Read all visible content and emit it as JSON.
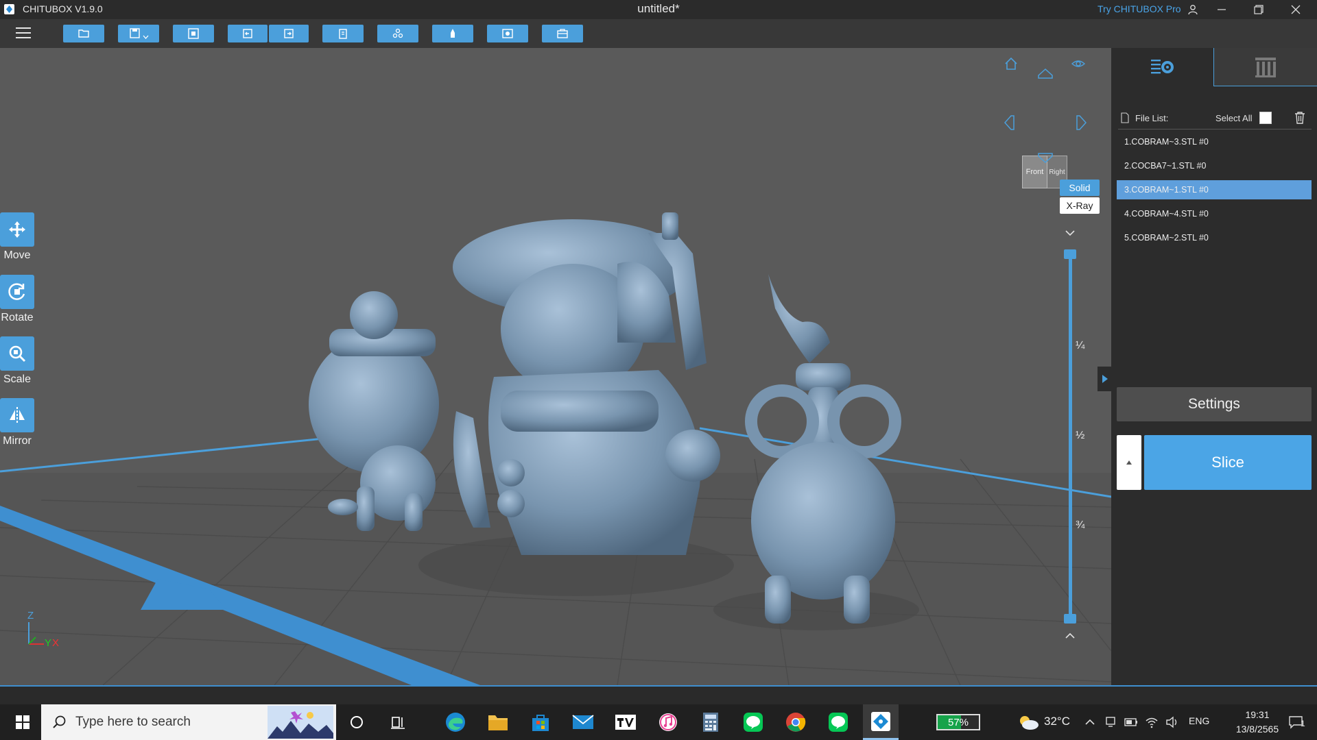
{
  "titlebar": {
    "app_title": "CHITUBOX V1.9.0",
    "document_title": "untitled*",
    "try_pro": "Try CHITUBOX Pro"
  },
  "toolbar": {
    "icons": [
      "open-file-icon",
      "save-icon",
      "screenshot-icon",
      "undo-icon",
      "redo-icon",
      "delete-icon",
      "support-icon",
      "hollow-icon",
      "auto-layout-icon",
      "package-icon"
    ]
  },
  "side_tools": [
    {
      "label": "Move",
      "icon": "move-icon"
    },
    {
      "label": "Rotate",
      "icon": "rotate-icon"
    },
    {
      "label": "Scale",
      "icon": "scale-icon"
    },
    {
      "label": "Mirror",
      "icon": "mirror-icon"
    }
  ],
  "viewcube": {
    "front": "Front",
    "right": "Right"
  },
  "render_modes": {
    "solid": "Solid",
    "xray": "X-Ray",
    "selected": "Solid"
  },
  "layer_slider": {
    "fractions": [
      "¼",
      "½",
      "¾"
    ]
  },
  "axes": {
    "z": "Z",
    "y": "Y",
    "x": "X"
  },
  "file_list": {
    "header": "File List:",
    "select_all": "Select All",
    "files": [
      "1.COBRAM~3.STL #0",
      "2.COCBA7~1.STL #0",
      "3.COBRAM~1.STL #0",
      "4.COBRAM~4.STL #0",
      "5.COBRAM~2.STL #0"
    ],
    "selected_index": 2
  },
  "panel": {
    "settings": "Settings",
    "slice": "Slice"
  },
  "taskbar": {
    "search_placeholder": "Type here to search",
    "battery": "57%",
    "battery_level": 0.57,
    "temperature": "32°C",
    "language": "ENG",
    "time": "19:31",
    "date": "13/8/2565",
    "notifications": "1"
  },
  "colors": {
    "accent": "#4b9fdb",
    "model": "#7d9ab5",
    "panel": "#2c2c2c",
    "viewport": "#5a5a5a"
  }
}
